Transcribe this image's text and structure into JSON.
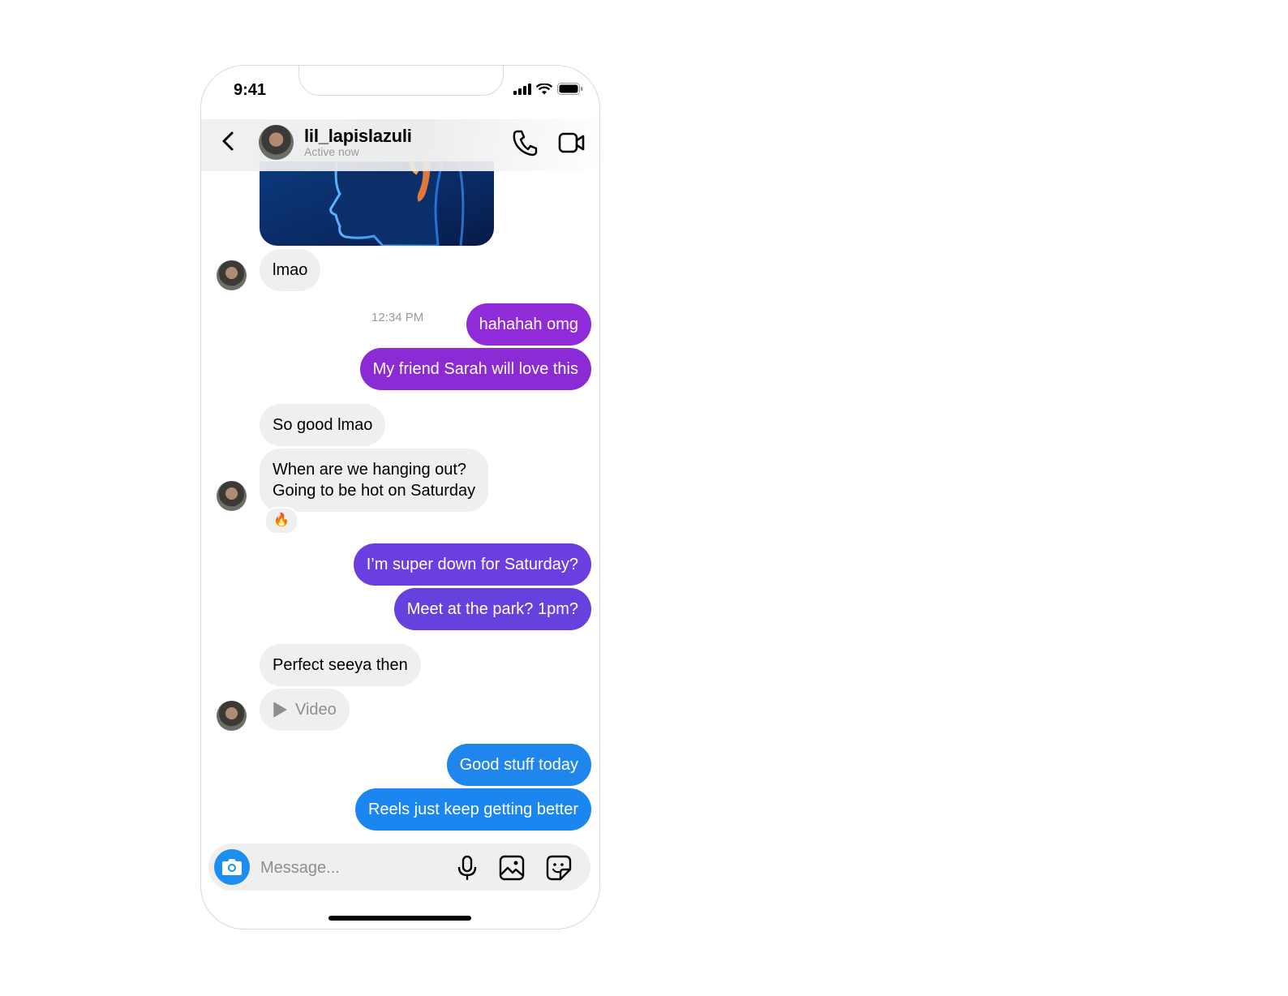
{
  "status_bar": {
    "time": "9:41"
  },
  "header": {
    "username": "lil_lapislazuli",
    "status": "Active now"
  },
  "messages": [
    {
      "from": "them",
      "text": "lmao"
    },
    {
      "timestamp": "12:34 PM"
    },
    {
      "from": "me",
      "text": "hahahah omg",
      "color": "#8f2bd9"
    },
    {
      "from": "me",
      "text": "My friend Sarah will love this",
      "color": "#8a2bd6"
    },
    {
      "from": "them",
      "text": "So good lmao"
    },
    {
      "from": "them",
      "line1": "When are we hanging out?",
      "line2": "Going to be hot on Saturday",
      "reaction": "🔥"
    },
    {
      "from": "me",
      "text": "I’m super down for Saturday?",
      "color": "#6b3fdf"
    },
    {
      "from": "me",
      "text": "Meet at the park? 1pm?",
      "color": "#6641de"
    },
    {
      "from": "them",
      "text": "Perfect seeya then"
    },
    {
      "from": "them",
      "text": "Video",
      "type": "video"
    },
    {
      "from": "me",
      "text": "Good stuff today",
      "color": "#1f86ee"
    },
    {
      "from": "me",
      "text": "Reels just keep getting better",
      "color": "#1b86ef"
    }
  ],
  "composer": {
    "placeholder": "Message..."
  },
  "colors": {
    "accent_blue": "#1b8ef0",
    "bubble_incoming": "#efefef"
  },
  "icons": [
    "back-arrow-icon",
    "phone-icon",
    "video-camera-icon",
    "camera-icon",
    "microphone-icon",
    "gallery-icon",
    "sticker-icon",
    "play-icon",
    "signal-icon",
    "wifi-icon",
    "battery-icon"
  ]
}
